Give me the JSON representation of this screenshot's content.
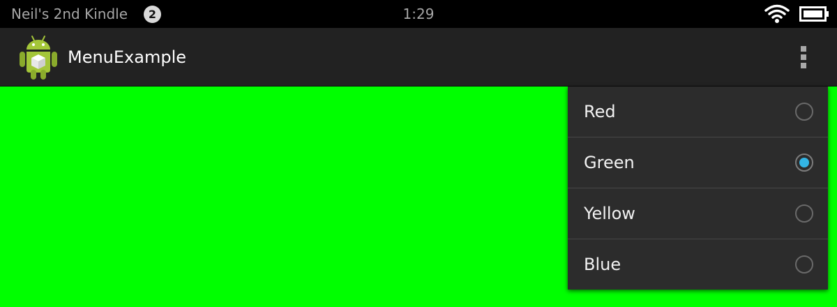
{
  "status_bar": {
    "device_name": "Neil's 2nd Kindle",
    "notification_count": "2",
    "time": "1:29",
    "wifi_icon": "wifi-icon",
    "battery_icon": "battery-icon"
  },
  "action_bar": {
    "app_icon": "android-robot-icon",
    "title": "MenuExample",
    "overflow_icon": "overflow-menu-icon"
  },
  "content": {
    "background_color": "#00ff00"
  },
  "menu": {
    "items": [
      {
        "label": "Red",
        "checked": false
      },
      {
        "label": "Green",
        "checked": true
      },
      {
        "label": "Yellow",
        "checked": false
      },
      {
        "label": "Blue",
        "checked": false
      }
    ],
    "accent_color": "#33b5e5"
  }
}
